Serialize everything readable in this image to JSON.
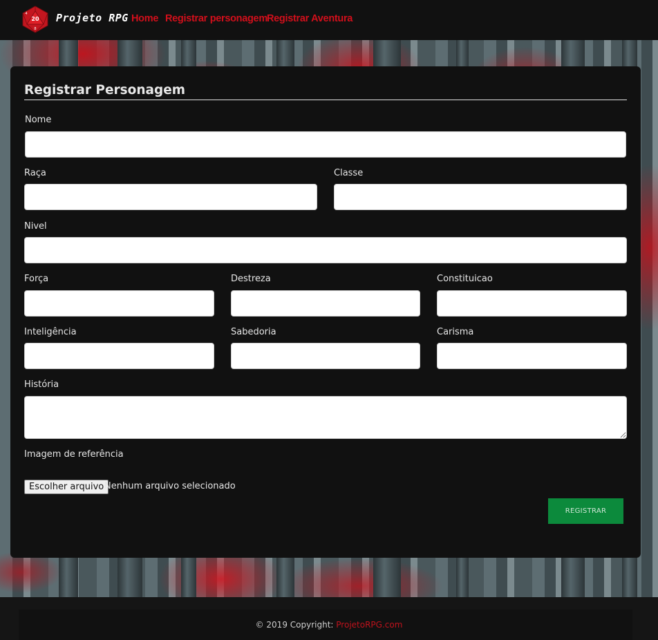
{
  "nav": {
    "brand": "Projeto RPG",
    "logo_number_top": "20",
    "logo_number_left": "4",
    "logo_number_bottom": "8",
    "links": [
      {
        "label": "Home"
      },
      {
        "label": "Registrar personagem"
      },
      {
        "label": "Registrar Aventura"
      }
    ]
  },
  "form": {
    "title": "Registrar Personagem",
    "fields": {
      "nome": {
        "label": "Nome",
        "value": ""
      },
      "raca": {
        "label": "Raça",
        "value": ""
      },
      "classe": {
        "label": "Classe",
        "value": ""
      },
      "nivel": {
        "label": "Nivel",
        "value": ""
      },
      "forca": {
        "label": "Força",
        "value": ""
      },
      "destreza": {
        "label": "Destreza",
        "value": ""
      },
      "constituicao": {
        "label": "Constituicao",
        "value": ""
      },
      "inteligencia": {
        "label": "Inteligência",
        "value": ""
      },
      "sabedoria": {
        "label": "Sabedoria",
        "value": ""
      },
      "carisma": {
        "label": "Carisma",
        "value": ""
      },
      "historia": {
        "label": "História",
        "value": ""
      },
      "imagem": {
        "label": "Imagem de referência"
      }
    },
    "file_button": "Escolher arquivo",
    "file_status": "Nenhum arquivo selecionado",
    "submit_label": "REGISTRAR"
  },
  "footer": {
    "text": "© 2019 Copyright:",
    "link": "ProjetoRPG.com"
  },
  "colors": {
    "nav_link": "#d20f1b",
    "submit": "#0c8a3c",
    "card": "#111111"
  }
}
